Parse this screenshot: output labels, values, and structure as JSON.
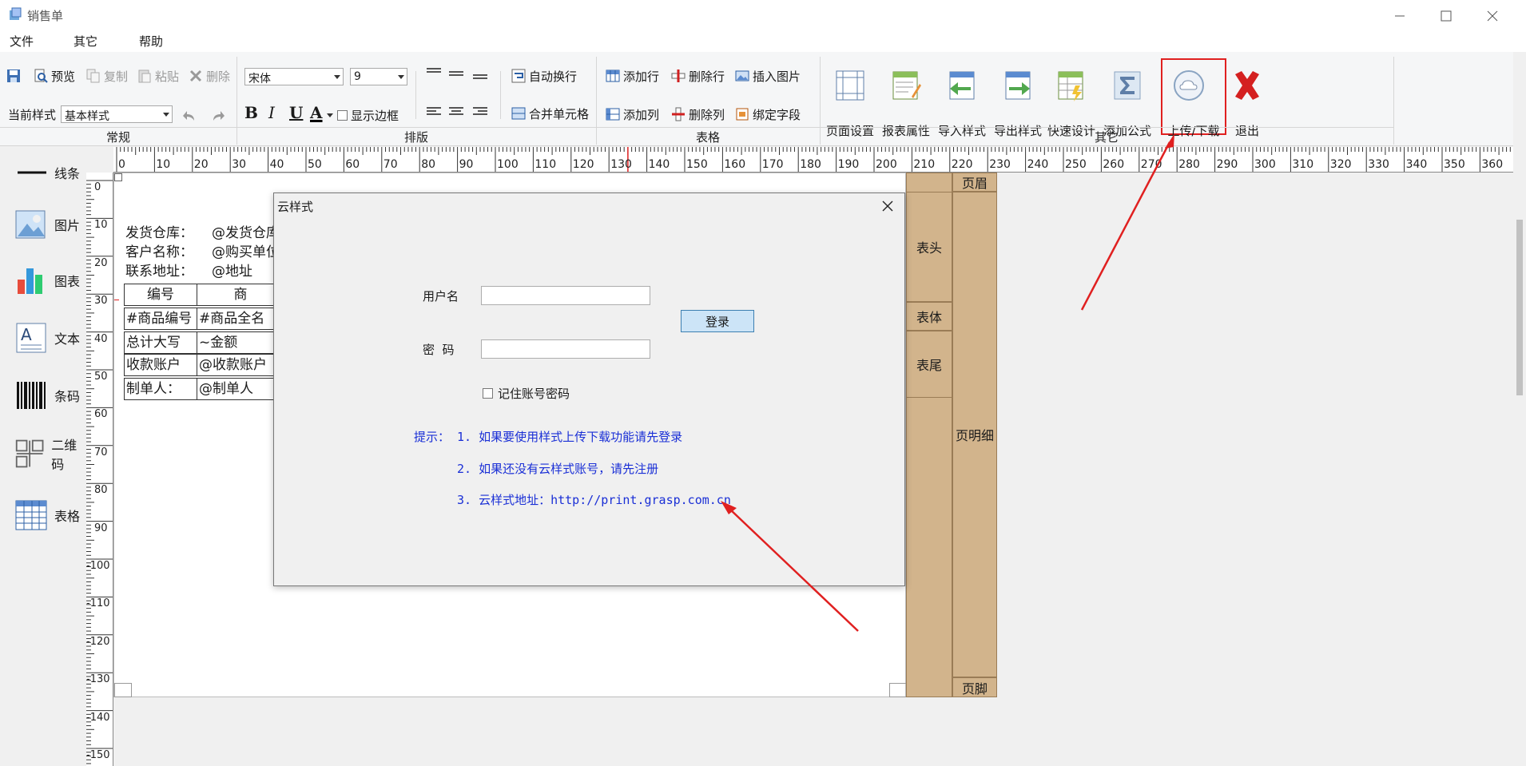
{
  "window": {
    "title": "销售单"
  },
  "menu": [
    "文件",
    "其它",
    "帮助"
  ],
  "toolbar": {
    "save": "",
    "preview": "预览",
    "copy": "复制",
    "paste": "粘贴",
    "delete": "删除",
    "font": "宋体",
    "font_size": "9",
    "current_style_label": "当前样式",
    "current_style": "基本样式",
    "bold": "B",
    "italic": "I",
    "underline": "U",
    "font_color": "A",
    "show_border": "显示边框",
    "auto_wrap": "自动换行",
    "merge_cells": "合并单元格",
    "add_row": "添加行",
    "delete_row": "删除行",
    "insert_image": "插入图片",
    "add_col": "添加列",
    "delete_col": "删除列",
    "bind_field": "绑定字段",
    "page_setup": "页面设置",
    "report_props": "报表属性",
    "import_style": "导入样式",
    "export_style": "导出样式",
    "quick_design": "快速设计",
    "add_formula": "添加公式",
    "upload_download": "上传/下载",
    "exit": "退出",
    "groups": {
      "general": "常规",
      "layout": "排版",
      "table": "表格",
      "other": "其它"
    }
  },
  "ruler": {
    "h": [
      "0",
      "10",
      "20",
      "30",
      "40",
      "50",
      "60",
      "70",
      "80",
      "90",
      "100",
      "110",
      "120",
      "130",
      "140",
      "150",
      "160",
      "170",
      "180",
      "190",
      "200",
      "210",
      "220",
      "230",
      "240",
      "250",
      "260",
      "270",
      "280",
      "290",
      "300",
      "310",
      "320",
      "330",
      "340",
      "350",
      "360"
    ],
    "v": [
      "0",
      "10",
      "20",
      "30",
      "40",
      "50",
      "60",
      "70",
      "80",
      "90",
      "100",
      "110",
      "120",
      "130",
      "140",
      "150"
    ]
  },
  "toolbox": [
    "线条",
    "图片",
    "图表",
    "文本",
    "条码",
    "二维码",
    "表格"
  ],
  "report": {
    "cells": {
      "warehouse_label": "发货仓库：",
      "warehouse_value": "@发货仓库",
      "customer_label": "客户名称：",
      "customer_value": "@购买单位",
      "address_label": "联系地址：",
      "address_value": "@地址",
      "col_code": "编号",
      "col_name": "商",
      "code_value": "#商品编号",
      "name_value": "#商品全名",
      "total_label": "总计大写",
      "total_value": "~金额",
      "account_label": "收款账户",
      "account_value": "@收款账户",
      "maker_label": "制单人：",
      "maker_value": "@制单人"
    },
    "bands": {
      "header": "表头",
      "body": "表体",
      "footer": "表尾",
      "page_header": "页眉",
      "page_detail": "页明细",
      "page_footer": "页脚"
    }
  },
  "dialog": {
    "title": "云样式",
    "username_label": "用户名",
    "username_value": "",
    "password_label": "密  码",
    "password_value": "",
    "login_button": "登录",
    "remember_label": "记住账号密码",
    "tips": {
      "prefix": "提示：",
      "line1": "1. 如果要使用样式上传下载功能请先登录",
      "line2": "2. 如果还没有云样式账号，请先注册",
      "line3": "3. 云样式地址：http://print.grasp.com.cn"
    }
  },
  "colors": {
    "band": "#d2b48c",
    "highlight": "#e02020",
    "tip_text": "#1a2fd6",
    "login_button": "#cce4f7"
  }
}
